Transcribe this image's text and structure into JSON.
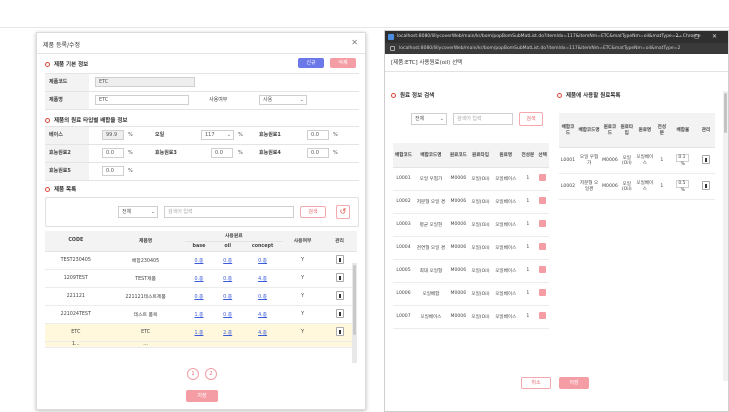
{
  "left_modal": {
    "title": "제품 등록/수정",
    "close": "✕",
    "section_basic": "제품 기본 정보",
    "btn_new": "신규",
    "btn_delete": "삭제",
    "code_label": "제품코드",
    "code_value": "ETC",
    "name_label": "제품명",
    "name_value": "ETC",
    "use_label": "사용여부",
    "use_value": "사용",
    "section_ratio": "제품의 원료 타입별 배합율 정보",
    "base_label": "베이스",
    "base_value": "99.9",
    "oil_label": "오일",
    "oil_value": "117",
    "eff1_label": "효능원료1",
    "eff1_value": "0.0",
    "eff2_label": "효능원료2",
    "eff2_value": "0.0",
    "eff3_label": "효능원료3",
    "eff3_value": "0.0",
    "eff4_label": "효능원료4",
    "eff4_value": "0.0",
    "eff5_label": "효능원료5",
    "eff5_value": "0.0",
    "pct": "%",
    "section_list": "제품 목록",
    "filter_value": "전체",
    "search_placeholder": "검색어 입력",
    "search_btn": "검색",
    "reset_icon": "↺",
    "table": {
      "h_code": "CODE",
      "h_name": "제품명",
      "h_group": "사용원료",
      "h_base": "base",
      "h_oil": "oil",
      "h_concept": "concept",
      "h_use": "사용여부",
      "h_manage": "관리",
      "rows": [
        {
          "code": "TEST230405",
          "name": "배합230405",
          "base": "0.종",
          "oil": "0.종",
          "concept": "0.종",
          "use": "Y"
        },
        {
          "code": "1209TEST",
          "name": "TEST제품",
          "base": "0.종",
          "oil": "0.종",
          "concept": "4.종",
          "use": "Y"
        },
        {
          "code": "221121",
          "name": "221121테스트제품",
          "base": "0.종",
          "oil": "0.종",
          "concept": "0.종",
          "use": "Y"
        },
        {
          "code": "221024TEST",
          "name": "테스트 품목",
          "base": "1.종",
          "oil": "0.종",
          "concept": "4.종",
          "use": "Y"
        },
        {
          "code": "ETC",
          "name": "ETC",
          "base": "1.종",
          "oil": "2.종",
          "concept": "4.종",
          "use": "Y"
        }
      ],
      "partial_row": {
        "code": "1...",
        "name": "...",
        "base": "",
        "oil": "",
        "concept": "",
        "use": ""
      }
    },
    "page1": "1",
    "page2": "2",
    "save_btn": "저장"
  },
  "right_window": {
    "chrome_title": "localhost:8080/lillycoverWeb/main/kr/bom/popBomSubMatList.do?itemIdx=117&itemNm=ETC&matTypeNm=oil&matType=2 - Chrome",
    "url": "localhost:8080/lillycoverWeb/main/kr/bom/popBomSubMatList.do?itemIdx=117&itemNm=ETC&matTypeNm=oil&matType=2",
    "ctrl_min": "—",
    "ctrl_max": "▢",
    "ctrl_close": "✕",
    "header": "[제품:ETC] 사용원료(oil) 선택",
    "section_search": "원료 정보 검색",
    "filter_value": "전체",
    "search_placeholder": "검색어 입력",
    "search_btn": "검색",
    "section_used": "제품에 사용할 원료목록",
    "left_table": {
      "h": [
        "배합코드",
        "배합코드명",
        "원료코드",
        "원료타입",
        "원료명",
        "전성분",
        "선택"
      ],
      "rows": [
        [
          "L0001",
          "오일 우협가",
          "M0006",
          "오일(Oil)",
          "오일베이스",
          "1"
        ],
        [
          "L0002",
          "저분형 오일 경",
          "M0006",
          "오일(Oil)",
          "오일베이스",
          "1"
        ],
        [
          "L0003",
          "평균 오일현",
          "M0006",
          "오일(Oil)",
          "오일베이스",
          "1"
        ],
        [
          "L0004",
          "천연형 오일 경",
          "M0006",
          "오일(Oil)",
          "오일베이스",
          "1"
        ],
        [
          "L0005",
          "최대 오일형",
          "M0006",
          "오일(Oil)",
          "오일베이스",
          "1"
        ],
        [
          "L0006",
          "오일배합",
          "M0006",
          "오일(Oil)",
          "오일베이스",
          "1"
        ],
        [
          "L0007",
          "오일베이스",
          "M0006",
          "오일(Oil)",
          "오일베이스",
          "1"
        ]
      ]
    },
    "right_table": {
      "h": [
        "배합코드",
        "배합코드명",
        "원료코드",
        "원료타입",
        "원료명",
        "전성분",
        "배합율",
        "관리"
      ],
      "rows": [
        [
          "L0001",
          "오일 우협가",
          "M0006",
          "오일(Oil)",
          "오일베이스",
          "1",
          "0.1"
        ],
        [
          "L0002",
          "저분형 오일경",
          "M0006",
          "오일(Oil)",
          "오일베이스",
          "1",
          "0.5"
        ]
      ]
    },
    "pct": "%",
    "cancel_btn": "취소",
    "ok_btn": "저장"
  }
}
